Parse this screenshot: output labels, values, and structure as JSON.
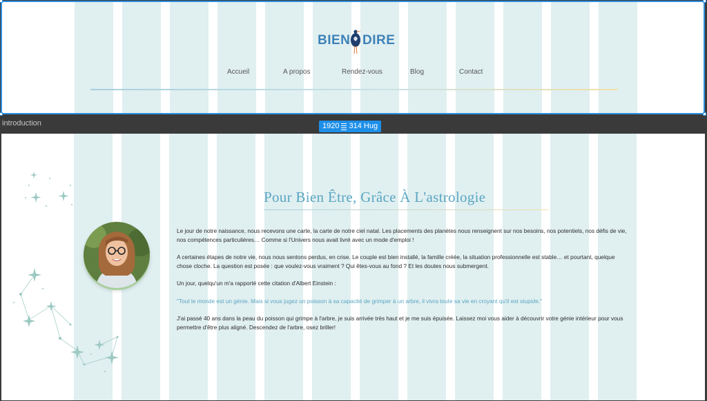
{
  "logo": {
    "left": "BIEN",
    "right": "DIRE"
  },
  "nav": [
    {
      "label": "Accueil"
    },
    {
      "label": "A propos"
    },
    {
      "label": "Rendez-vous"
    },
    {
      "label": "Blog"
    },
    {
      "label": "Contact"
    }
  ],
  "canvas": {
    "frame_label": "introduction",
    "size_badge": {
      "width": "1920",
      "height": "314 Hug"
    }
  },
  "intro": {
    "title": "Pour Bien Être, Grâce À L'astrologie",
    "paragraphs": [
      "Le jour de notre naissance, nous recevons une carte, la carte de notre ciel natal. Les placements des planètes nous renseignent sur nos besoins, nos potentiels, nos défis de vie, nos compétences particulières… Comme si l'Univers nous avait livré avec un mode d'emploi !",
      "A certaines étapes de notre vie, nous nous sentons perdus, en crise. Le couple est bien installé, la famille créée, la situation professionnelle est stable… et pourtant, quelque chose cloche. La question est posée : que voulez-vous vraiment ? Qui êtes-vous au fond ? Et les doutes nous submergent.",
      "Un jour, quelqu'un m'a rapporté cette citation d'Albert Einstein :",
      "\"Tout le monde est un génie. Mais si vous jugez un poisson à sa capacité de grimper à un arbre, il vivra toute sa vie en croyant qu'il est stupide.\"",
      "J'ai passé 40 ans dans la peau du poisson qui grimpe à l'arbre, je suis arrivée très haut et je me suis épuisée. Laissez moi vous aider à découvrir votre génie intérieur pour vous permettre d'être plus aligné. Descendez de l'arbre, osez briller!"
    ]
  },
  "colors": {
    "accent": "#5aa6c2",
    "selection": "#1e8fe8",
    "grid": "#e0eff0"
  }
}
